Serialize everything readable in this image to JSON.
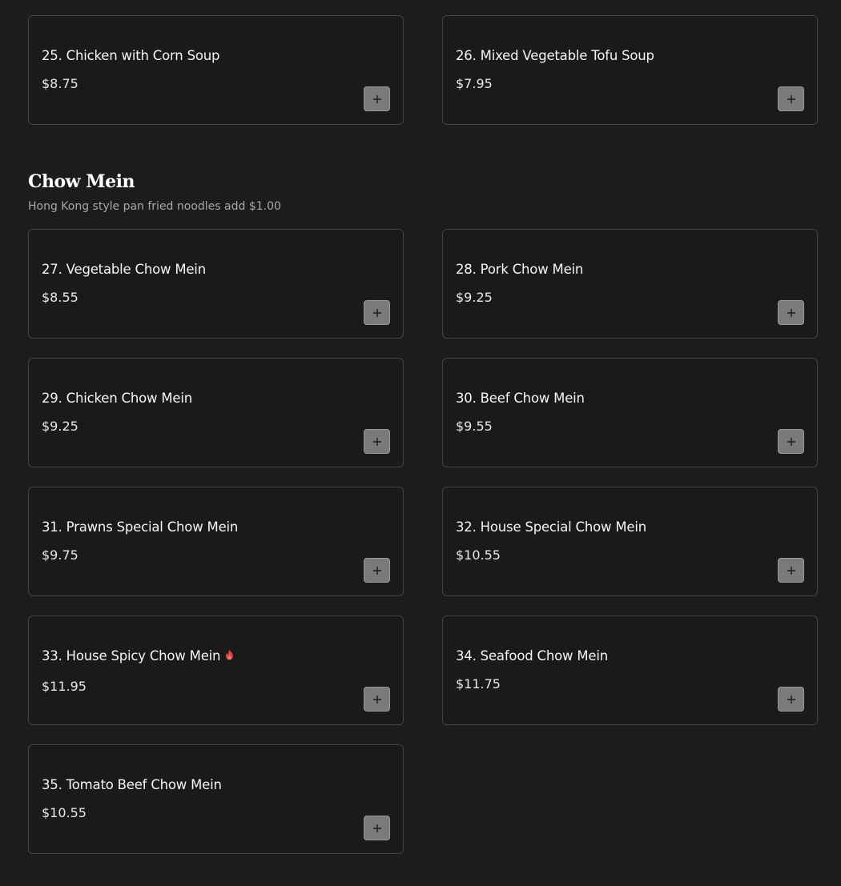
{
  "soups": {
    "items": [
      {
        "name": "25. Chicken with Corn Soup",
        "price": "$8.75"
      },
      {
        "name": "26. Mixed Vegetable Tofu Soup",
        "price": "$7.95"
      }
    ]
  },
  "chow_mein": {
    "title": "Chow Mein",
    "subtitle": "Hong Kong style pan fried noodles add $1.00",
    "items": [
      {
        "name": "27. Vegetable Chow Mein",
        "price": "$8.55"
      },
      {
        "name": "28. Pork Chow Mein",
        "price": "$9.25"
      },
      {
        "name": "29. Chicken Chow Mein",
        "price": "$9.25"
      },
      {
        "name": "30. Beef Chow Mein",
        "price": "$9.55"
      },
      {
        "name": "31. Prawns Special Chow Mein",
        "price": "$9.75"
      },
      {
        "name": "32. House Special Chow Mein",
        "price": "$10.55"
      },
      {
        "name": "33. House Spicy Chow Mein",
        "price": "$11.95",
        "icon": "fire-icon"
      },
      {
        "name": "34. Seafood Chow Mein",
        "price": "$11.75"
      },
      {
        "name": "35. Tomato Beef Chow Mein",
        "price": "$10.55"
      }
    ]
  },
  "colors": {
    "background": "#1c1c1c",
    "card_border": "#444444",
    "add_button": "#7a7a7a",
    "spicy_icon": "#e0483e"
  },
  "icons": {
    "add_button": "plus-icon",
    "spicy": "fire-icon"
  }
}
